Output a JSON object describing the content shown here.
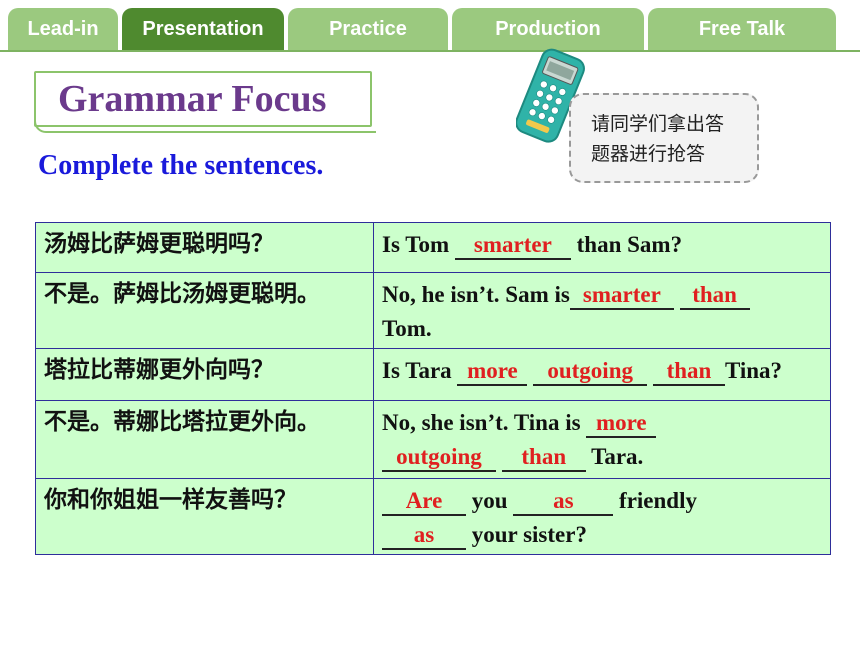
{
  "tabs": [
    {
      "label": "Lead-in",
      "active": false
    },
    {
      "label": "Presentation",
      "active": true
    },
    {
      "label": "Practice",
      "active": false
    },
    {
      "label": "Production",
      "active": false
    },
    {
      "label": "Free Talk",
      "active": false
    }
  ],
  "title": "Grammar Focus",
  "subtitle": "Complete the sentences.",
  "callout": {
    "line1": "请同学们拿出答",
    "line2": "题器进行抢答"
  },
  "rows": [
    {
      "cn": "汤姆比萨姆更聪明吗？",
      "en": {
        "t1": "Is Tom ",
        "a1": "smarter",
        "t2": " than Sam?"
      }
    },
    {
      "cn": "不是。萨姆比汤姆更聪明。",
      "en": {
        "t1": "No, he isn’t. Sam is",
        "a1": "smarter",
        "a2": "than",
        "t2": "Tom."
      }
    },
    {
      "cn": "塔拉比蒂娜更外向吗？",
      "en": {
        "t1": "Is Tara ",
        "a1": "more",
        "a2": "outgoing",
        "a3": "than",
        "t2": "Tina?"
      }
    },
    {
      "cn": "不是。蒂娜比塔拉更外向。",
      "en": {
        "t1": "No, she isn’t. Tina is ",
        "a1": "more",
        "a2": "outgoing",
        "a3": "than",
        "t2": " Tara."
      }
    },
    {
      "cn": "你和你姐姐一样友善吗？",
      "en": {
        "a1": "Are",
        "t1": " you ",
        "a2": "as",
        "t2": " friendly",
        "a3": "as",
        "t3": " your sister?"
      }
    }
  ],
  "colors": {
    "tab_inactive": "#9bc97f",
    "tab_active": "#4f8a2f",
    "title": "#6b3a8c",
    "subtitle": "#1a1adb",
    "answer": "#e02020",
    "table_bg": "#ccffcc"
  },
  "icons": {
    "clicker": "answer-clicker-device-icon"
  }
}
